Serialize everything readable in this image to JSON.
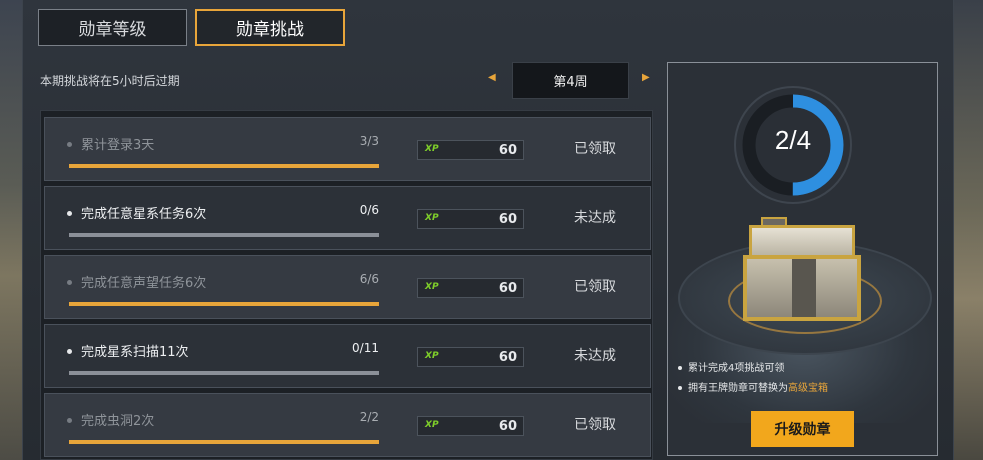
{
  "tabs": [
    {
      "label": "勋章等级",
      "active": false
    },
    {
      "label": "勋章挑战",
      "active": true
    }
  ],
  "expire_text": "本期挑战将在5小时后过期",
  "week": {
    "label": "第4周",
    "prev_icon": "caret-left-icon",
    "next_icon": "caret-right-icon"
  },
  "tasks": [
    {
      "name": "累计登录3天",
      "progress": "3/3",
      "fill": 1.0,
      "xp_label": "XP",
      "xp": "60",
      "status": "已领取",
      "state": "done"
    },
    {
      "name": "完成任意星系任务6次",
      "progress": "0/6",
      "fill": 0.0,
      "xp_label": "XP",
      "xp": "60",
      "status": "未达成",
      "state": "todo"
    },
    {
      "name": "完成任意声望任务6次",
      "progress": "6/6",
      "fill": 1.0,
      "xp_label": "XP",
      "xp": "60",
      "status": "已领取",
      "state": "done"
    },
    {
      "name": "完成星系扫描11次",
      "progress": "0/11",
      "fill": 0.0,
      "xp_label": "XP",
      "xp": "60",
      "status": "未达成",
      "state": "todo"
    },
    {
      "name": "完成虫洞2次",
      "progress": "2/2",
      "fill": 1.0,
      "xp_label": "XP",
      "xp": "60",
      "status": "已领取",
      "state": "done"
    }
  ],
  "reward": {
    "counter": "2/4",
    "counter_fraction": 0.5,
    "note1": "累计完成4项挑战可领",
    "note2_prefix": "拥有王牌勋章可替换为",
    "note2_highlight": "高级宝箱",
    "button_label": "升级勋章"
  },
  "colors": {
    "accent": "#e8a53a",
    "ring": "#2e8fe0",
    "xp_green": "#7fcf2a",
    "button": "#f2a71c"
  }
}
